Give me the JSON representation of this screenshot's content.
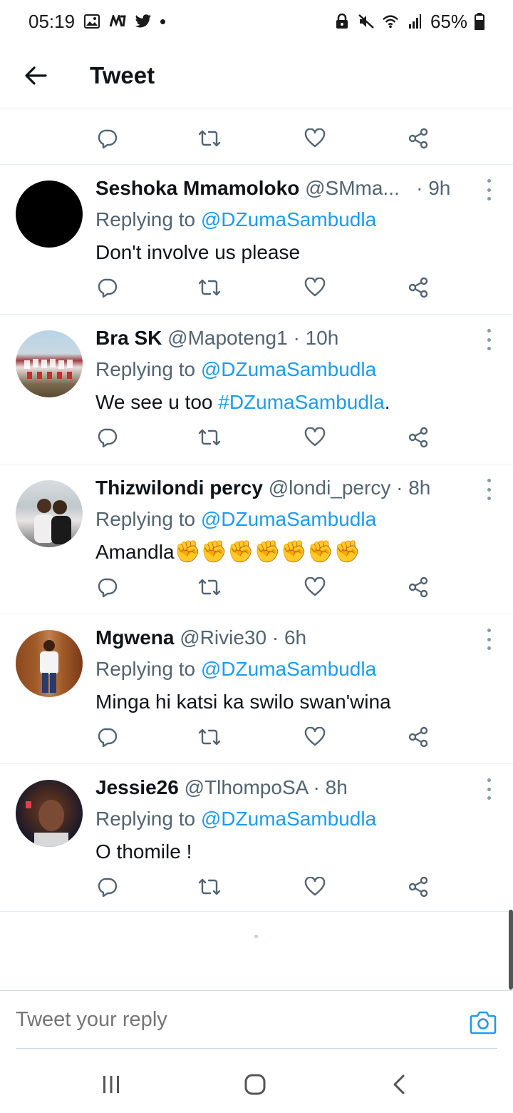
{
  "status_bar": {
    "time": "05:19",
    "battery": "65%"
  },
  "header": {
    "title": "Tweet"
  },
  "reply_prefix": "Replying to",
  "tweets": [
    {
      "name": "Seshoka Mmamoloko",
      "handle": "@SMma...",
      "time": "9h",
      "replying_to": "@DZumaSambudla",
      "text": "Don't involve us please"
    },
    {
      "name": "Bra SK",
      "handle": "@Mapoteng1",
      "time": "10h",
      "replying_to": "@DZumaSambudla",
      "text_prefix": "We see u too ",
      "hashtag": "#DZumaSambudla",
      "text_suffix": "."
    },
    {
      "name": "Thizwilondi percy",
      "handle": "@londi_percy",
      "time": "8h",
      "replying_to": "@DZumaSambudla",
      "text": "Amandla",
      "emoji": "✊✊✊✊✊✊✊"
    },
    {
      "name": "Mgwena",
      "handle": "@Rivie30",
      "time": "6h",
      "replying_to": "@DZumaSambudla",
      "text": "Minga hi katsi ka swilo swan'wina"
    },
    {
      "name": "Jessie26",
      "handle": "@TlhompoSA",
      "time": "8h",
      "replying_to": "@DZumaSambudla",
      "text": "O thomile !"
    }
  ],
  "composer": {
    "placeholder": "Tweet your reply"
  },
  "colors": {
    "link": "#1d9bf0",
    "secondary_text": "#536471",
    "primary_text": "#0f1419",
    "divider": "#e6ecf0"
  },
  "icons": {
    "reply": "reply-icon",
    "retweet": "retweet-icon",
    "like": "like-icon",
    "share": "share-icon",
    "more": "more-icon",
    "back": "back-arrow-icon",
    "camera": "camera-icon"
  }
}
